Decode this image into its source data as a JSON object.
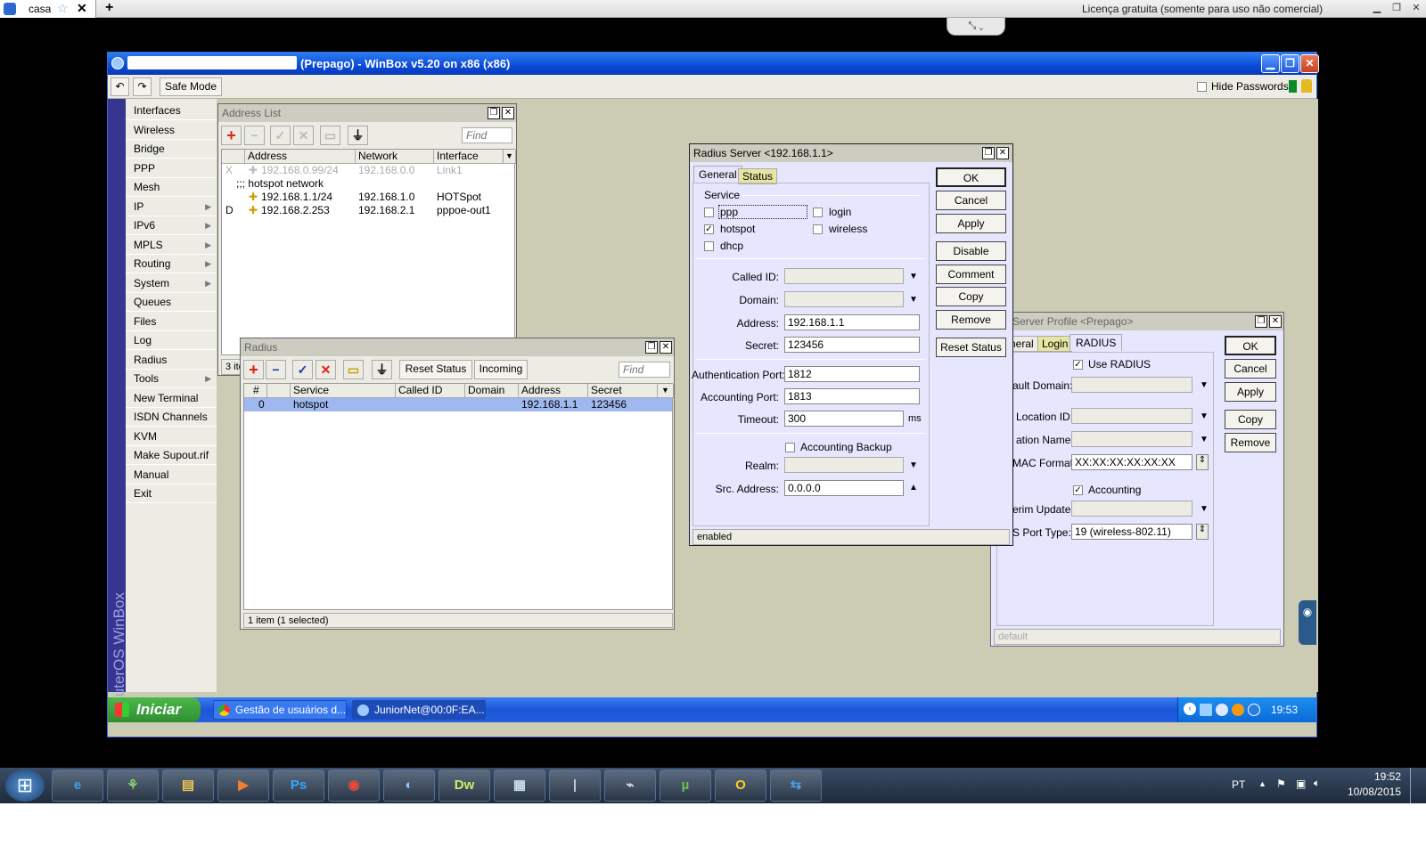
{
  "viewer": {
    "tab_label": "casa",
    "license_text": "Licença gratuita (somente para uso não comercial)"
  },
  "winbox": {
    "title": "(Prepago) - WinBox v5.20 on x86 (x86)",
    "toolbar": {
      "safe_mode": "Safe Mode",
      "hide_passwords": "Hide Passwords"
    },
    "side_brand": "RouterOS WinBox",
    "menu": [
      {
        "label": "Interfaces",
        "sub": false
      },
      {
        "label": "Wireless",
        "sub": false
      },
      {
        "label": "Bridge",
        "sub": false
      },
      {
        "label": "PPP",
        "sub": false
      },
      {
        "label": "Mesh",
        "sub": false
      },
      {
        "label": "IP",
        "sub": true
      },
      {
        "label": "IPv6",
        "sub": true
      },
      {
        "label": "MPLS",
        "sub": true
      },
      {
        "label": "Routing",
        "sub": true
      },
      {
        "label": "System",
        "sub": true
      },
      {
        "label": "Queues",
        "sub": false
      },
      {
        "label": "Files",
        "sub": false
      },
      {
        "label": "Log",
        "sub": false
      },
      {
        "label": "Radius",
        "sub": false
      },
      {
        "label": "Tools",
        "sub": true
      },
      {
        "label": "New Terminal",
        "sub": false
      },
      {
        "label": "ISDN Channels",
        "sub": false
      },
      {
        "label": "KVM",
        "sub": false
      },
      {
        "label": "Make Supout.rif",
        "sub": false
      },
      {
        "label": "Manual",
        "sub": false
      },
      {
        "label": "Exit",
        "sub": false
      }
    ]
  },
  "address_list": {
    "title": "Address List",
    "find_placeholder": "Find",
    "columns": [
      "Address",
      "Network",
      "Interface"
    ],
    "rows": [
      {
        "flag": "X",
        "address": "192.168.0.99/24",
        "network": "192.168.0.0",
        "interface": "Link1",
        "disabled": true
      },
      {
        "comment": ";;; hotspot network"
      },
      {
        "flag": "",
        "address": "192.168.1.1/24",
        "network": "192.168.1.0",
        "interface": "HOTSpot",
        "disabled": false
      },
      {
        "flag": "D",
        "address": "192.168.2.253",
        "network": "192.168.2.1",
        "interface": "pppoe-out1",
        "disabled": false
      }
    ],
    "status": "3 ite"
  },
  "radius_list": {
    "title": "Radius",
    "reset_status": "Reset Status",
    "incoming": "Incoming",
    "find_placeholder": "Find",
    "columns": [
      "#",
      "Service",
      "Called ID",
      "Domain",
      "Address",
      "Secret"
    ],
    "row": {
      "num": "0",
      "service": "hotspot",
      "called_id": "",
      "domain": "",
      "address": "192.168.1.1",
      "secret": "123456"
    },
    "status": "1 item (1 selected)"
  },
  "radius_server": {
    "title": "Radius Server <192.168.1.1>",
    "tabs": [
      "General",
      "Status"
    ],
    "service_label": "Service",
    "services": [
      {
        "label": "ppp",
        "checked": false
      },
      {
        "label": "login",
        "checked": false
      },
      {
        "label": "hotspot",
        "checked": true
      },
      {
        "label": "wireless",
        "checked": false
      },
      {
        "label": "dhcp",
        "checked": false
      }
    ],
    "called_id_label": "Called ID:",
    "domain_label": "Domain:",
    "address_label": "Address:",
    "address": "192.168.1.1",
    "secret_label": "Secret:",
    "secret": "123456",
    "auth_port_label": "Authentication Port:",
    "auth_port": "1812",
    "acct_port_label": "Accounting Port:",
    "acct_port": "1813",
    "timeout_label": "Timeout:",
    "timeout": "300",
    "timeout_unit": "ms",
    "acct_backup_label": "Accounting Backup",
    "realm_label": "Realm:",
    "src_address_label": "Src. Address:",
    "src_address": "0.0.0.0",
    "status": "enabled",
    "buttons": [
      "OK",
      "Cancel",
      "Apply",
      "Disable",
      "Comment",
      "Copy",
      "Remove",
      "Reset Status"
    ]
  },
  "hotspot_profile": {
    "title": "pot Server Profile <Prepago>",
    "tabs": [
      "neral",
      "Login",
      "RADIUS"
    ],
    "use_radius": "Use RADIUS",
    "default_domain_label": "ault Domain:",
    "location_id_label": "Location ID:",
    "location_name_label": "ation Name:",
    "mac_format_label": "MAC Format:",
    "mac_format": "XX:XX:XX:XX:XX:XX",
    "accounting_label": "Accounting",
    "interim_update_label": "erim Update:",
    "nas_port_type_label": "S Port Type:",
    "nas_port_type": "19 (wireless-802.11)",
    "status": "default",
    "buttons": [
      "OK",
      "Cancel",
      "Apply",
      "Copy",
      "Remove"
    ]
  },
  "xp_taskbar": {
    "start": "Iniciar",
    "items": [
      "Gestão de usuários d...",
      "JuniorNet@00:0F:EA..."
    ],
    "clock": "19:53"
  },
  "win7_taskbar": {
    "apps": [
      "ie-icon",
      "pendrive-icon",
      "explorer-icon",
      "media-icon",
      "photoshop-icon",
      "chrome-icon",
      "winbox-icon",
      "dreamweaver-icon",
      "calculator-icon",
      "usb-icon",
      "network-icon",
      "utorrent-icon",
      "o-app-icon",
      "teamviewer-icon"
    ],
    "app_labels": {
      "photoshop": "Ps",
      "dreamweaver": "Dw"
    },
    "lang": "PT",
    "time": "19:52",
    "date": "10/08/2015"
  }
}
